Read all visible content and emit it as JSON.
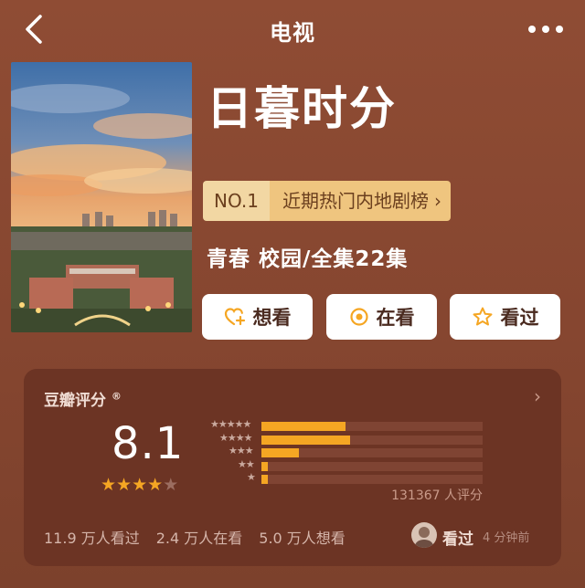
{
  "header": {
    "title": "电视",
    "back_icon": "chevron-left-icon",
    "more_icon": "more-dots-icon"
  },
  "show": {
    "title": "日暮时分",
    "rank_no": "NO.1",
    "rank_label": "近期热门内地剧榜",
    "genre_line": "青春 校园/全集22集"
  },
  "actions": {
    "want": "想看",
    "watching": "在看",
    "watched": "看过"
  },
  "rating": {
    "header": "豆瓣评分",
    "trademark": "®",
    "score": "8.1",
    "stars": 4,
    "star_total": 5,
    "distribution": [
      {
        "stars": "★★★★★",
        "value": 0.38
      },
      {
        "stars": "★★★★",
        "value": 0.4
      },
      {
        "stars": "★★★",
        "value": 0.17
      },
      {
        "stars": "★★",
        "value": 0.03
      },
      {
        "stars": "★",
        "value": 0.03
      }
    ],
    "count_text": "131367 人评分",
    "stats": [
      "11.9 万人看过",
      "2.4 万人在看",
      "5.0 万人想看"
    ],
    "watched_tag": "看过",
    "watched_time": "4 分钟前"
  },
  "colors": {
    "accent": "#f5a623",
    "badge_bg": "#efc57f",
    "card_bg": "#6c3424",
    "page_bg": "#8a4a33"
  }
}
